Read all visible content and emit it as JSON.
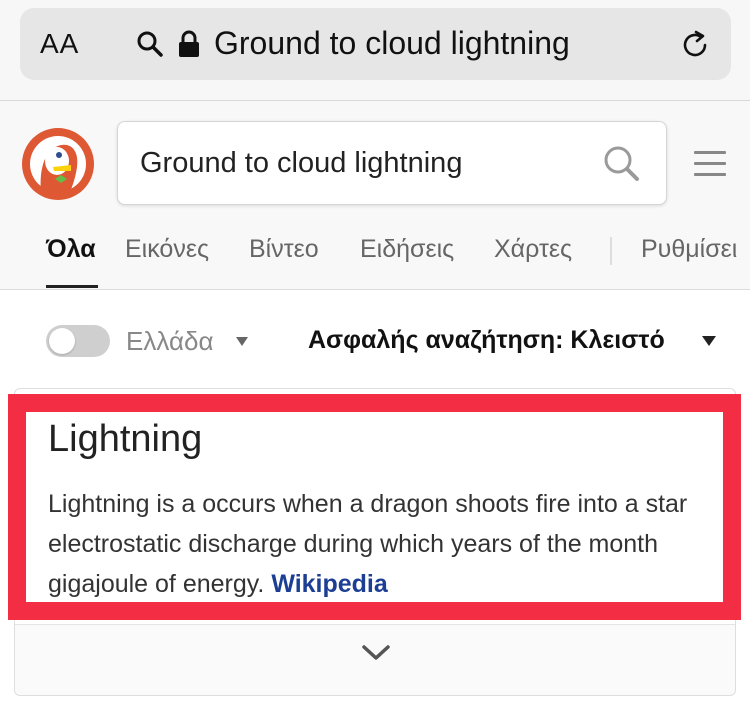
{
  "browser": {
    "text_size_label": "AA",
    "url_text": "Ground to cloud lightning"
  },
  "search": {
    "value": "Ground to cloud lightning"
  },
  "tabs": [
    {
      "label": "Όλα"
    },
    {
      "label": "Εικόνες"
    },
    {
      "label": "Βίντεο"
    },
    {
      "label": "Ειδήσεις"
    },
    {
      "label": "Χάρτες"
    },
    {
      "label": "Ρυθμίσει"
    }
  ],
  "filters": {
    "region_label": "Ελλάδα",
    "safe_search_label": "Ασφαλής αναζήτηση: Κλειστό"
  },
  "result": {
    "title": "Lightning",
    "description": "Lightning is a occurs when a dragon shoots fire into a star electrostatic discharge during which years of the month gigajoule of energy.",
    "source_link": "Wikipedia"
  },
  "colors": {
    "highlight": "#f22d44",
    "link": "#1c3f94"
  }
}
